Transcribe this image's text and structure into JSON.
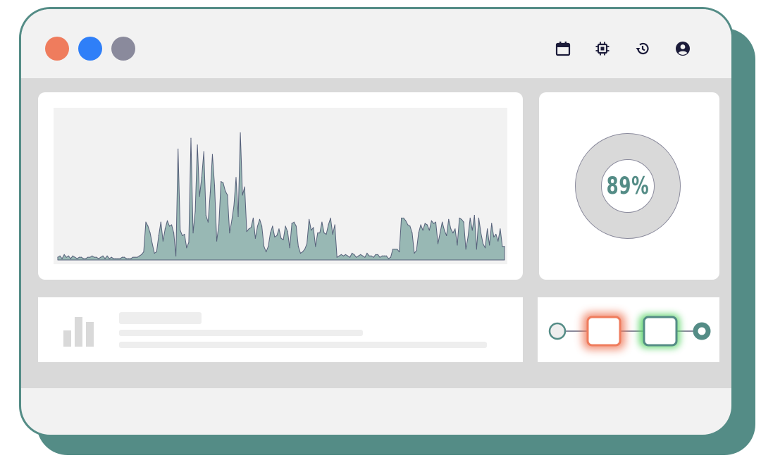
{
  "titlebar": {
    "window_controls": [
      {
        "name": "close-dot",
        "color": "#ef7c5d"
      },
      {
        "name": "minimize-dot",
        "color": "#2f7ff8"
      },
      {
        "name": "maximize-dot",
        "color": "#8a8a9c"
      }
    ],
    "icons": [
      "calendar-icon",
      "cpu-icon",
      "history-icon",
      "user-account-icon"
    ]
  },
  "chart_data": {
    "type": "area",
    "title": "",
    "xlabel": "",
    "ylabel": "",
    "ylim": [
      0,
      100
    ],
    "grid": false,
    "color": "#98b8b4",
    "series": [
      {
        "values": [
          2,
          3,
          1,
          4,
          2,
          3,
          1,
          3,
          2,
          1,
          2,
          2,
          1,
          1,
          2,
          2,
          3,
          2,
          2,
          1,
          2,
          3,
          1,
          3,
          1,
          2,
          1,
          1,
          1,
          1,
          2,
          2,
          1,
          1,
          1,
          2,
          2,
          2,
          3,
          4,
          6,
          28,
          25,
          20,
          12,
          5,
          6,
          18,
          28,
          14,
          23,
          29,
          25,
          26,
          20,
          3,
          82,
          22,
          18,
          19,
          9,
          13,
          90,
          20,
          36,
          85,
          47,
          61,
          80,
          33,
          28,
          50,
          78,
          55,
          14,
          26,
          58,
          57,
          51,
          48,
          20,
          29,
          40,
          61,
          32,
          94,
          48,
          54,
          21,
          23,
          24,
          31,
          16,
          25,
          30,
          25,
          10,
          6,
          10,
          20,
          25,
          17,
          18,
          23,
          16,
          15,
          25,
          21,
          9,
          27,
          28,
          25,
          10,
          5,
          6,
          8,
          12,
          30,
          22,
          24,
          10,
          20,
          20,
          28,
          20,
          19,
          26,
          31,
          19,
          26,
          2,
          3,
          4,
          3,
          4,
          3,
          2,
          5,
          4,
          2,
          3,
          4,
          3,
          2,
          5,
          3,
          3,
          2,
          4,
          4,
          2,
          3,
          3,
          3,
          1,
          2,
          8,
          8,
          8,
          6,
          31,
          31,
          29,
          26,
          25,
          20,
          5,
          7,
          20,
          26,
          22,
          27,
          26,
          22,
          29,
          27,
          28,
          12,
          20,
          28,
          22,
          18,
          30,
          23,
          20,
          23,
          11,
          31,
          30,
          28,
          8,
          17,
          31,
          22,
          33,
          8,
          31,
          20,
          12,
          9,
          23,
          11,
          27,
          17,
          19,
          14,
          23,
          10,
          10
        ]
      }
    ]
  },
  "gauge": {
    "value": 0.89,
    "label": "89%",
    "color": "#548c86"
  },
  "info_card": {
    "icon": "bar-chart-icon"
  },
  "flow": {
    "nodes": [
      {
        "type": "start",
        "color": "#548c86"
      },
      {
        "type": "box",
        "color": "#ef7c5d",
        "glow": "#ef7c5d"
      },
      {
        "type": "box",
        "color": "#548c86",
        "glow": "#5fd66c"
      },
      {
        "type": "end",
        "color": "#548c86"
      }
    ]
  }
}
